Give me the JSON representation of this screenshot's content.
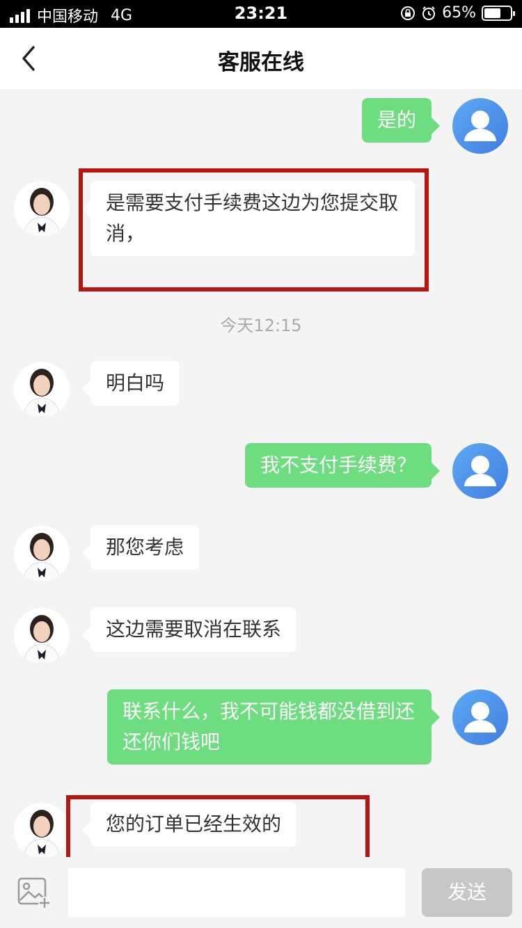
{
  "status_bar": {
    "carrier": "中国移动",
    "network": "4G",
    "time": "23:21",
    "battery_percent": "65%",
    "battery_level": 0.65
  },
  "header": {
    "title": "客服在线",
    "back_icon": "chevron-left-icon"
  },
  "messages": [
    {
      "from": "user",
      "text": "是的"
    },
    {
      "from": "agent",
      "text": "是需要支付手续费这边为您提交取消，",
      "highlighted": true
    },
    {
      "from": "agent",
      "text": "明白吗"
    },
    {
      "from": "user",
      "text": "我不支付手续费？"
    },
    {
      "from": "agent",
      "text": "那您考虑"
    },
    {
      "from": "agent",
      "text": "这边需要取消在联系"
    },
    {
      "from": "user",
      "text": "联系什么，我不可能钱都没借到还还你们钱吧"
    },
    {
      "from": "agent",
      "text": "您的订单已经生效的",
      "highlighted": true
    }
  ],
  "timestamp": "今天12:15",
  "input_bar": {
    "image_icon": "image-add-icon",
    "placeholder": "",
    "send_label": "发送"
  },
  "colors": {
    "user_bubble": "#6ddd80",
    "agent_bubble": "#ffffff",
    "highlight": "#b8150f",
    "user_avatar": "#4a90e8",
    "send_disabled": "#c7c7c7"
  }
}
